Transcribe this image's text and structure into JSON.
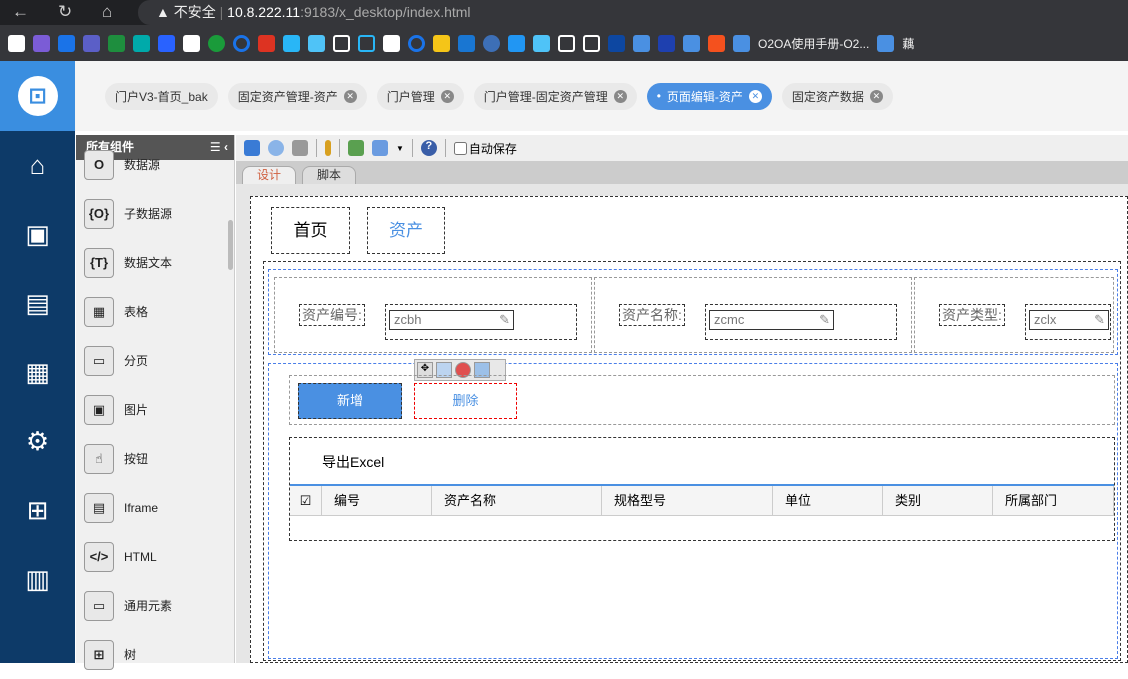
{
  "browser": {
    "warning": "不安全",
    "host": "10.8.222.11",
    "path": ":9183/x_desktop/index.html",
    "bookmark_texts": [
      "O2OA使用手册-O2...",
      "藕"
    ]
  },
  "tabs": [
    {
      "label": "门户V3-首页_bak",
      "active": false,
      "closable": false
    },
    {
      "label": "固定资产管理-资产",
      "active": false,
      "closable": true
    },
    {
      "label": "门户管理",
      "active": false,
      "closable": true
    },
    {
      "label": "门户管理-固定资产管理",
      "active": false,
      "closable": true
    },
    {
      "label": "页面编辑-资产",
      "active": true,
      "closable": true
    },
    {
      "label": "固定资产数据",
      "active": false,
      "closable": true
    }
  ],
  "components": {
    "title": "所有组件",
    "items": [
      {
        "label": "数据源",
        "icon": "O"
      },
      {
        "label": "子数据源",
        "icon": "{O}"
      },
      {
        "label": "数据文本",
        "icon": "{T}"
      },
      {
        "label": "表格",
        "icon": "▦"
      },
      {
        "label": "分页",
        "icon": "▭"
      },
      {
        "label": "图片",
        "icon": "▣"
      },
      {
        "label": "按钮",
        "icon": "☝"
      },
      {
        "label": "Iframe",
        "icon": "▤"
      },
      {
        "label": "HTML",
        "icon": "</>"
      },
      {
        "label": "通用元素",
        "icon": "▭"
      },
      {
        "label": "树",
        "icon": "⊞"
      }
    ]
  },
  "toolbar": {
    "autosave": "自动保存"
  },
  "design_tabs": {
    "design": "设计",
    "script": "脚本"
  },
  "page": {
    "nav": [
      "首页",
      "资产"
    ],
    "fields": [
      {
        "label": "资产编号:",
        "value": "zcbh"
      },
      {
        "label": "资产名称:",
        "value": "zcmc"
      },
      {
        "label": "资产类型:",
        "value": "zclx"
      }
    ],
    "buttons": {
      "add": "新增",
      "delete": "删除"
    },
    "export": "导出Excel",
    "columns": [
      "编号",
      "资产名称",
      "规格型号",
      "单位",
      "类别",
      "所属部门"
    ]
  },
  "colors": {
    "accent": "#4a90e2",
    "nav": "#0d3a68"
  }
}
